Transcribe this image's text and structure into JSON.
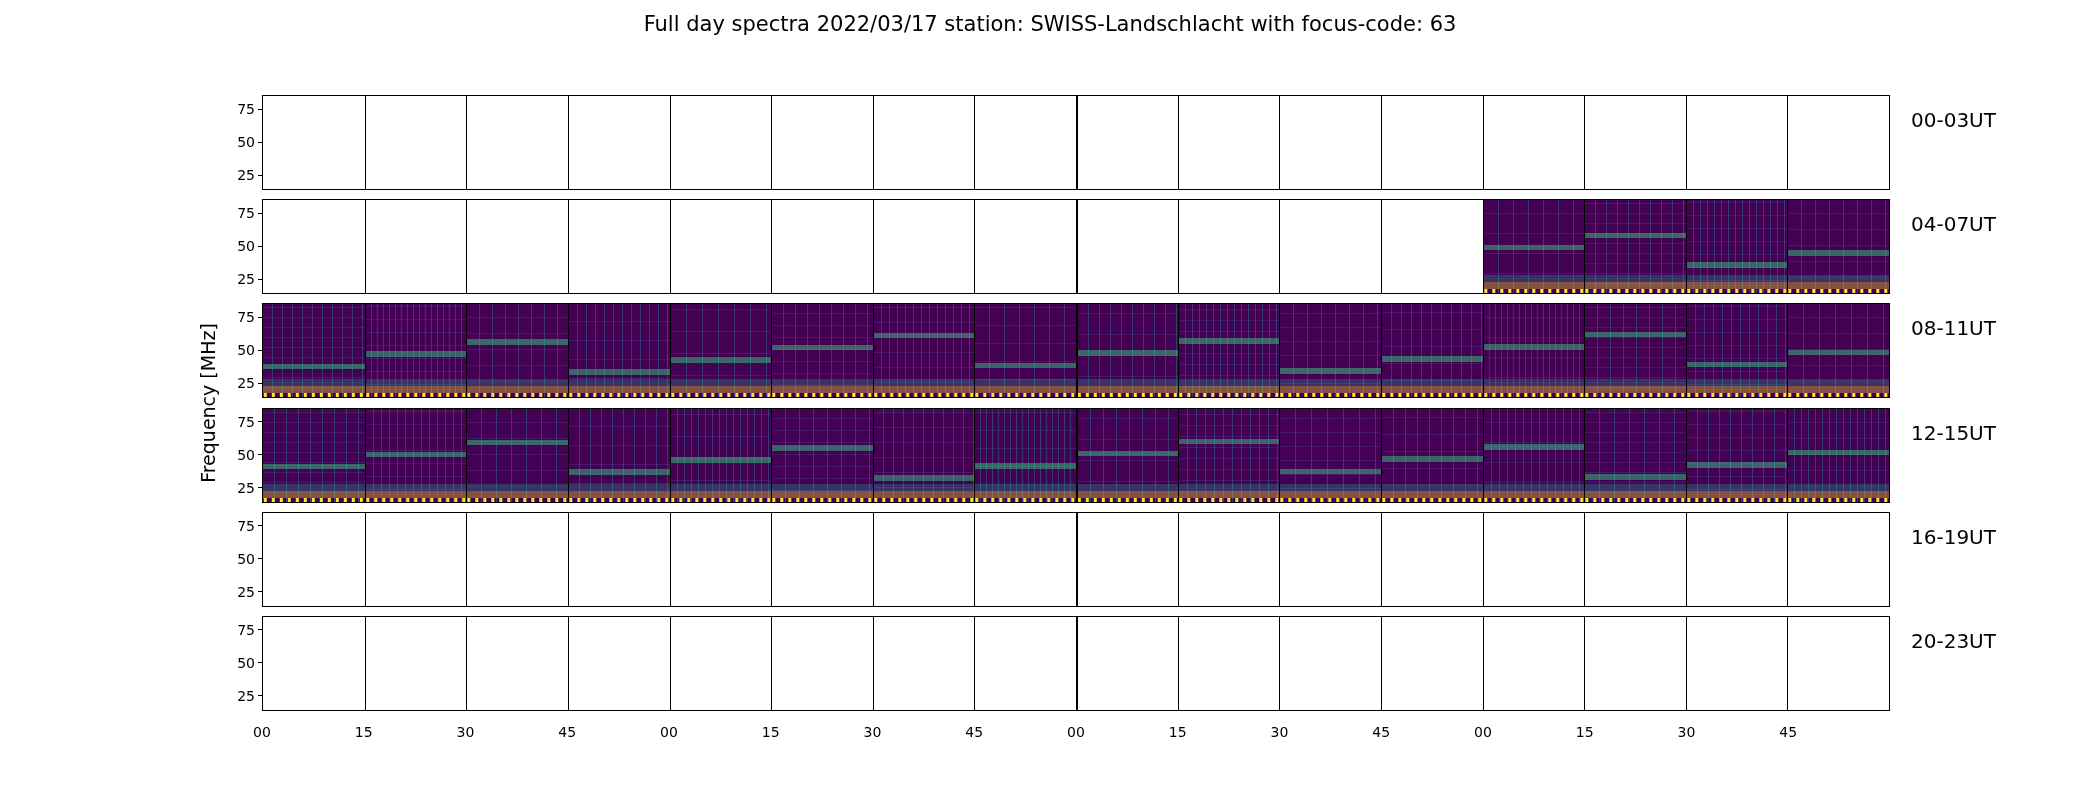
{
  "title": "Full day spectra 2022/03/17 station: SWISS-Landschlacht with focus-code: 63",
  "ylabel": "Frequency [MHz]",
  "xticks": [
    "00",
    "15",
    "30",
    "45",
    "00",
    "15",
    "30",
    "45",
    "00",
    "15",
    "30",
    "45",
    "00",
    "15",
    "30",
    "45"
  ],
  "rows": [
    {
      "label": "00-03UT",
      "yticks": [
        "75",
        "50",
        "25"
      ],
      "cells": [
        {
          "filled": false
        },
        {
          "filled": false
        },
        {
          "filled": false
        },
        {
          "filled": false
        },
        {
          "filled": false
        },
        {
          "filled": false
        },
        {
          "filled": false
        },
        {
          "filled": false
        },
        {
          "filled": false
        },
        {
          "filled": false
        },
        {
          "filled": false
        },
        {
          "filled": false
        },
        {
          "filled": false
        },
        {
          "filled": false
        },
        {
          "filled": false
        },
        {
          "filled": false
        }
      ]
    },
    {
      "label": "04-07UT",
      "yticks": [
        "75",
        "50",
        "25"
      ],
      "cells": [
        {
          "filled": false
        },
        {
          "filled": false
        },
        {
          "filled": false
        },
        {
          "filled": false
        },
        {
          "filled": false
        },
        {
          "filled": false
        },
        {
          "filled": false
        },
        {
          "filled": false
        },
        {
          "filled": false
        },
        {
          "filled": false
        },
        {
          "filled": false
        },
        {
          "filled": false
        },
        {
          "filled": true
        },
        {
          "filled": true
        },
        {
          "filled": true
        },
        {
          "filled": true
        }
      ]
    },
    {
      "label": "08-11UT",
      "yticks": [
        "75",
        "50",
        "25"
      ],
      "cells": [
        {
          "filled": true
        },
        {
          "filled": true
        },
        {
          "filled": true
        },
        {
          "filled": true
        },
        {
          "filled": true
        },
        {
          "filled": true
        },
        {
          "filled": true
        },
        {
          "filled": true
        },
        {
          "filled": true
        },
        {
          "filled": true
        },
        {
          "filled": true
        },
        {
          "filled": true
        },
        {
          "filled": true
        },
        {
          "filled": true
        },
        {
          "filled": true
        },
        {
          "filled": true
        }
      ]
    },
    {
      "label": "12-15UT",
      "yticks": [
        "75",
        "50",
        "25"
      ],
      "cells": [
        {
          "filled": true
        },
        {
          "filled": true
        },
        {
          "filled": true
        },
        {
          "filled": true
        },
        {
          "filled": true
        },
        {
          "filled": true
        },
        {
          "filled": true
        },
        {
          "filled": true
        },
        {
          "filled": true
        },
        {
          "filled": true
        },
        {
          "filled": true
        },
        {
          "filled": true
        },
        {
          "filled": true
        },
        {
          "filled": true
        },
        {
          "filled": true
        },
        {
          "filled": true
        }
      ]
    },
    {
      "label": "16-19UT",
      "yticks": [
        "75",
        "50",
        "25"
      ],
      "cells": [
        {
          "filled": false
        },
        {
          "filled": false
        },
        {
          "filled": false
        },
        {
          "filled": false
        },
        {
          "filled": false
        },
        {
          "filled": false
        },
        {
          "filled": false
        },
        {
          "filled": false
        },
        {
          "filled": false
        },
        {
          "filled": false
        },
        {
          "filled": false
        },
        {
          "filled": false
        },
        {
          "filled": false
        },
        {
          "filled": false
        },
        {
          "filled": false
        },
        {
          "filled": false
        }
      ]
    },
    {
      "label": "20-23UT",
      "yticks": [
        "75",
        "50",
        "25"
      ],
      "cells": [
        {
          "filled": false
        },
        {
          "filled": false
        },
        {
          "filled": false
        },
        {
          "filled": false
        },
        {
          "filled": false
        },
        {
          "filled": false
        },
        {
          "filled": false
        },
        {
          "filled": false
        },
        {
          "filled": false
        },
        {
          "filled": false
        },
        {
          "filled": false
        },
        {
          "filled": false
        },
        {
          "filled": false
        },
        {
          "filled": false
        },
        {
          "filled": false
        },
        {
          "filled": false
        }
      ]
    }
  ]
}
